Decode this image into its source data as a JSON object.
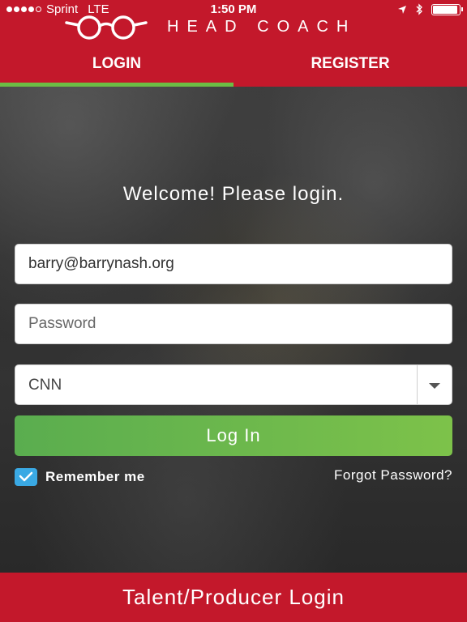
{
  "status_bar": {
    "carrier": "Sprint",
    "network": "LTE",
    "time": "1:50 PM",
    "signal_bars_filled": 4,
    "signal_bars_total": 5,
    "battery_level": 0.95
  },
  "brand": {
    "name": "HEAD COACH",
    "logo_icon": "glasses-icon"
  },
  "tabs": [
    {
      "label": "LOGIN",
      "active": true
    },
    {
      "label": "REGISTER",
      "active": false
    }
  ],
  "form": {
    "welcome": "Welcome! Please login.",
    "email_value": "barry@barrynash.org",
    "password_placeholder": "Password",
    "network_selected": "CNN",
    "login_label": "Log In",
    "remember_label": "Remember me",
    "remember_checked": true,
    "forgot_label": "Forgot Password?"
  },
  "footer": {
    "label": "Talent/Producer Login"
  },
  "colors": {
    "brand_red": "#c3182b",
    "accent_green": "#6cbd45",
    "checkbox_blue": "#3aa9e4"
  }
}
